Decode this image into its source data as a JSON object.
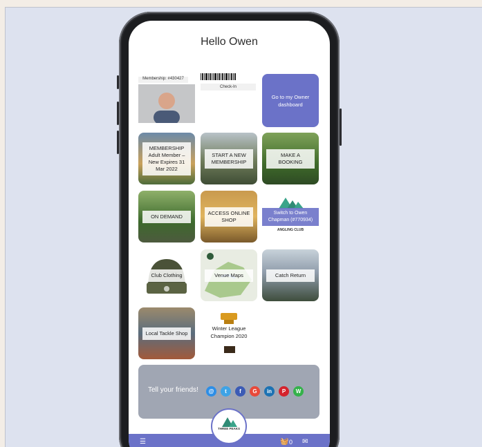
{
  "header": {
    "greeting": "Hello Owen"
  },
  "membership_card": {
    "number": "Membership: #430427",
    "checkin": "Check-In"
  },
  "owner": {
    "dashboard_label": "Go to my Owner dashboard"
  },
  "tiles": {
    "membership": "MEMBERSHIP Adult Member – New Expires 31 Mar 2022",
    "start_membership": "START A NEW MEMBERSHIP",
    "booking": "MAKE A BOOKING",
    "on_demand": "ON DEMAND",
    "shop": "ACCESS ONLINE SHOP",
    "switch": "Switch to Owen Chapman (#770934)",
    "club_name": "ANGLING CLUB",
    "clothing": "Club Clothing",
    "maps": "Venue Maps",
    "catch": "Catch Return",
    "tackle": "Local Tackle Shop",
    "trophy": "Winter League Champion 2020"
  },
  "share": {
    "label": "Tell your friends!",
    "icons": [
      "@",
      "t",
      "f",
      "G",
      "in",
      "P",
      "W"
    ]
  },
  "footer": {
    "basket_count": "0",
    "logo_text": "THREE PEAKS"
  },
  "colors": {
    "accent": "#6b72c8",
    "share_bg": "#a0a6b3"
  }
}
